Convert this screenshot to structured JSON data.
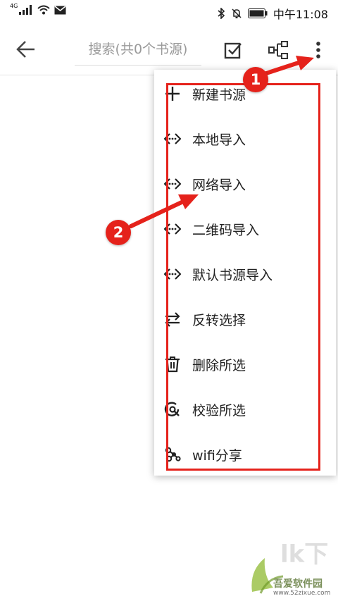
{
  "status_bar": {
    "network_tag": "4G",
    "clock": "中午11:08"
  },
  "toolbar": {
    "search_placeholder": "搜索(共0个书源)"
  },
  "menu": {
    "items": [
      {
        "label": "新建书源",
        "icon": "plus-icon"
      },
      {
        "label": "本地导入",
        "icon": "code-icon"
      },
      {
        "label": "网络导入",
        "icon": "code-icon"
      },
      {
        "label": "二维码导入",
        "icon": "code-icon"
      },
      {
        "label": "默认书源导入",
        "icon": "code-icon"
      },
      {
        "label": "反转选择",
        "icon": "swap-icon"
      },
      {
        "label": "删除所选",
        "icon": "trash-icon"
      },
      {
        "label": "校验所选",
        "icon": "check-search-icon"
      },
      {
        "label": "wifi分享",
        "icon": "share-icon"
      }
    ]
  },
  "annotation": {
    "badge_1": "1",
    "badge_2": "2",
    "color": "#e5221b"
  },
  "watermark": {
    "title": "吾爱软件园",
    "url": "www.52zixue.com"
  }
}
